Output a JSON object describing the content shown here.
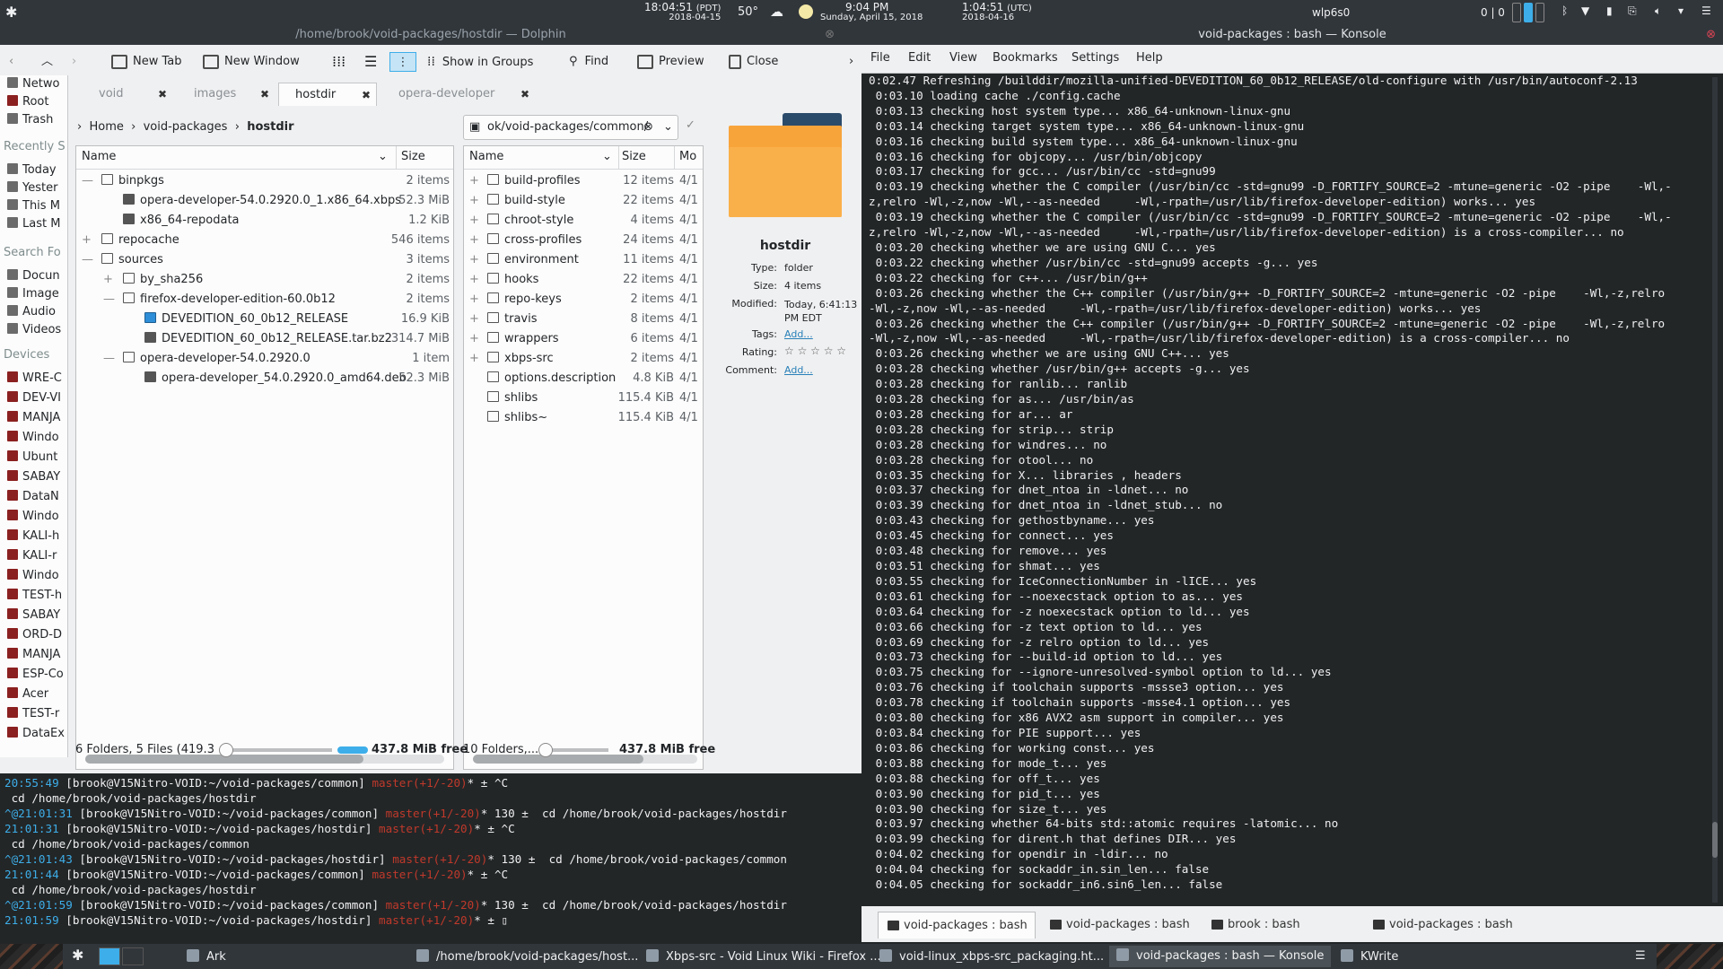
{
  "topbar": {
    "app_icon": "kde-icon",
    "time_pdt": "18:04:51",
    "tz_pdt": "(PDT)",
    "date_pdt": "2018-04-15",
    "temp": "50°",
    "time_local": "9:04 PM",
    "date_local": "Sunday, April 15, 2018",
    "time_utc": "1:04:51",
    "tz_utc": "(UTC)",
    "date_utc": "2018-04-16",
    "network": "wlp6s0",
    "counter": "0 | 0"
  },
  "dolphin": {
    "window_title": "/home/brook/void-packages/hostdir — Dolphin",
    "toolbar": {
      "new_tab": "New Tab",
      "new_window": "New Window",
      "show_in_groups": "Show in Groups",
      "find": "Find",
      "preview": "Preview",
      "close": "Close"
    },
    "places": {
      "items_top": [
        "Netwo",
        "Root",
        "Trash"
      ],
      "recent_header": "Recently S",
      "recent": [
        "Today",
        "Yester",
        "This M",
        "Last M"
      ],
      "search_header": "Search Fo",
      "search": [
        "Docun",
        "Image",
        "Audio",
        "Videos"
      ],
      "devices_header": "Devices",
      "devices": [
        "WRE-C",
        "DEV-VI",
        "MANJA",
        "Windo",
        "Ubunt",
        "SABAY",
        "DataN",
        "Windo",
        "KALI-h",
        "KALI-r",
        "Windo",
        "TEST-h",
        "SABAY",
        "ORD-D",
        "MANJA",
        "ESP-Co",
        "Acer",
        "TEST-r",
        "DataEx"
      ]
    },
    "tabs": [
      {
        "label": "void"
      },
      {
        "label": "images"
      },
      {
        "label": "hostdir"
      },
      {
        "label": "opera-developer"
      }
    ],
    "left_pane": {
      "breadcrumb": [
        "Home",
        "void-packages",
        "hostdir"
      ],
      "col_name": "Name",
      "col_size": "Size",
      "rows": [
        {
          "expander": "—",
          "name": "binpkgs",
          "size": "2 items"
        },
        {
          "expander": "",
          "name": "opera-developer-54.0.2920.0_1.x86_64.xbps",
          "size": "52.3 MiB"
        },
        {
          "expander": "",
          "name": "x86_64-repodata",
          "size": "1.2 KiB"
        },
        {
          "expander": "+",
          "name": "repocache",
          "size": "546 items"
        },
        {
          "expander": "—",
          "name": "sources",
          "size": "3 items"
        },
        {
          "expander": "+",
          "name": "by_sha256",
          "size": "2 items"
        },
        {
          "expander": "—",
          "name": "firefox-developer-edition-60.0b12",
          "size": "2 items"
        },
        {
          "expander": "",
          "name": "DEVEDITION_60_0b12_RELEASE",
          "size": "16.9 KiB"
        },
        {
          "expander": "",
          "name": "DEVEDITION_60_0b12_RELEASE.tar.bz2",
          "size": "314.7 MiB"
        },
        {
          "expander": "—",
          "name": "opera-developer-54.0.2920.0",
          "size": "1 item"
        },
        {
          "expander": "",
          "name": "opera-developer_54.0.2920.0_amd64.deb",
          "size": "52.3 MiB"
        }
      ],
      "status": "6 Folders, 5 Files (419.3 ...",
      "free": "437.8 MiB free"
    },
    "right_pane": {
      "location": "ok/void-packages/common/",
      "col_name": "Name",
      "col_size": "Size",
      "col_mod": "Mo",
      "rows": [
        {
          "name": "build-profiles",
          "size": "12 items",
          "mod": "4/1"
        },
        {
          "name": "build-style",
          "size": "22 items",
          "mod": "4/1"
        },
        {
          "name": "chroot-style",
          "size": "4 items",
          "mod": "4/1"
        },
        {
          "name": "cross-profiles",
          "size": "24 items",
          "mod": "4/1"
        },
        {
          "name": "environment",
          "size": "11 items",
          "mod": "4/1"
        },
        {
          "name": "hooks",
          "size": "22 items",
          "mod": "4/1"
        },
        {
          "name": "repo-keys",
          "size": "2 items",
          "mod": "4/1"
        },
        {
          "name": "travis",
          "size": "8 items",
          "mod": "4/1"
        },
        {
          "name": "wrappers",
          "size": "6 items",
          "mod": "4/1"
        },
        {
          "name": "xbps-src",
          "size": "2 items",
          "mod": "4/1"
        },
        {
          "name": "options.description",
          "size": "4.8 KiB",
          "mod": "4/1"
        },
        {
          "name": "shlibs",
          "size": "115.4 KiB",
          "mod": "4/1"
        },
        {
          "name": "shlibs~",
          "size": "115.4 KiB",
          "mod": "4/1"
        }
      ],
      "status": "10 Folders,...",
      "free": "437.8 MiB free"
    },
    "info": {
      "name": "hostdir",
      "type_label": "Type:",
      "type": "folder",
      "size_label": "Size:",
      "size": "4 items",
      "modified_label": "Modified:",
      "modified": "Today, 6:41:13 PM EDT",
      "tags_label": "Tags:",
      "tags": "Add...",
      "rating_label": "Rating:",
      "rating": "☆ ☆ ☆ ☆ ☆",
      "comment_label": "Comment:",
      "comment": "Add..."
    }
  },
  "konsole": {
    "window_title": "void-packages : bash — Konsole",
    "menu": [
      "File",
      "Edit",
      "View",
      "Bookmarks",
      "Settings",
      "Help"
    ],
    "lines": [
      "0:02.47 Refreshing /builddir/mozilla-unified-DEVEDITION_60_0b12_RELEASE/old-configure with /usr/bin/autoconf-2.13",
      " 0:03.10 loading cache ./config.cache",
      " 0:03.13 checking host system type... x86_64-unknown-linux-gnu",
      " 0:03.14 checking target system type... x86_64-unknown-linux-gnu",
      " 0:03.16 checking build system type... x86_64-unknown-linux-gnu",
      " 0:03.16 checking for objcopy... /usr/bin/objcopy",
      " 0:03.17 checking for gcc... /usr/bin/cc -std=gnu99",
      " 0:03.19 checking whether the C compiler (/usr/bin/cc -std=gnu99 -D_FORTIFY_SOURCE=2 -mtune=generic -O2 -pipe    -Wl,-",
      "z,relro -Wl,-z,now -Wl,--as-needed     -Wl,-rpath=/usr/lib/firefox-developer-edition) works... yes",
      " 0:03.19 checking whether the C compiler (/usr/bin/cc -std=gnu99 -D_FORTIFY_SOURCE=2 -mtune=generic -O2 -pipe    -Wl,-",
      "z,relro -Wl,-z,now -Wl,--as-needed     -Wl,-rpath=/usr/lib/firefox-developer-edition) is a cross-compiler... no",
      " 0:03.20 checking whether we are using GNU C... yes",
      " 0:03.22 checking whether /usr/bin/cc -std=gnu99 accepts -g... yes",
      " 0:03.22 checking for c++... /usr/bin/g++",
      " 0:03.26 checking whether the C++ compiler (/usr/bin/g++ -D_FORTIFY_SOURCE=2 -mtune=generic -O2 -pipe    -Wl,-z,relro",
      "-Wl,-z,now -Wl,--as-needed     -Wl,-rpath=/usr/lib/firefox-developer-edition) works... yes",
      " 0:03.26 checking whether the C++ compiler (/usr/bin/g++ -D_FORTIFY_SOURCE=2 -mtune=generic -O2 -pipe    -Wl,-z,relro",
      "-Wl,-z,now -Wl,--as-needed     -Wl,-rpath=/usr/lib/firefox-developer-edition) is a cross-compiler... no",
      " 0:03.26 checking whether we are using GNU C++... yes",
      " 0:03.28 checking whether /usr/bin/g++ accepts -g... yes",
      " 0:03.28 checking for ranlib... ranlib",
      " 0:03.28 checking for as... /usr/bin/as",
      " 0:03.28 checking for ar... ar",
      " 0:03.28 checking for strip... strip",
      " 0:03.28 checking for windres... no",
      " 0:03.28 checking for otool... no",
      " 0:03.35 checking for X... libraries , headers",
      " 0:03.37 checking for dnet_ntoa in -ldnet... no",
      " 0:03.39 checking for dnet_ntoa in -ldnet_stub... no",
      " 0:03.43 checking for gethostbyname... yes",
      " 0:03.45 checking for connect... yes",
      " 0:03.48 checking for remove... yes",
      " 0:03.51 checking for shmat... yes",
      " 0:03.55 checking for IceConnectionNumber in -lICE... yes",
      " 0:03.61 checking for --noexecstack option to as... yes",
      " 0:03.64 checking for -z noexecstack option to ld... yes",
      " 0:03.66 checking for -z text option to ld... yes",
      " 0:03.69 checking for -z relro option to ld... yes",
      " 0:03.73 checking for --build-id option to ld... yes",
      " 0:03.75 checking for --ignore-unresolved-symbol option to ld... yes",
      " 0:03.76 checking if toolchain supports -mssse3 option... yes",
      " 0:03.78 checking if toolchain supports -msse4.1 option... yes",
      " 0:03.80 checking for x86 AVX2 asm support in compiler... yes",
      " 0:03.84 checking for PIE support... yes",
      " 0:03.86 checking for working const... yes",
      " 0:03.88 checking for mode_t... yes",
      " 0:03.88 checking for off_t... yes",
      " 0:03.90 checking for pid_t... yes",
      " 0:03.90 checking for size_t... yes",
      " 0:03.97 checking whether 64-bits std::atomic requires -latomic... no",
      " 0:03.99 checking for dirent.h that defines DIR... yes",
      " 0:04.02 checking for opendir in -ldir... no",
      " 0:04.04 checking for sockaddr_in.sin_len... false",
      " 0:04.05 checking for sockaddr_in6.sin6_len... false"
    ],
    "tabs": [
      "void-packages : bash",
      "void-packages : bash",
      "brook : bash",
      "void-packages : bash"
    ]
  },
  "embedded_terminal": {
    "lines": [
      {
        "time": "20:55:49",
        "prompt": " [brook@V15Nitro-VOID:~/void-packages/common]",
        "git": " master(+1/-20)",
        "tail": "* ± ^C"
      },
      {
        "time": "",
        "prompt": " cd /home/brook/void-packages/hostdir",
        "git": "",
        "tail": ""
      },
      {
        "time": "^@21:01:31",
        "prompt": " [brook@V15Nitro-VOID:~/void-packages/common]",
        "git": " master(+1/-20)",
        "tail": "* 130 ±  cd /home/brook/void-packages/hostdir"
      },
      {
        "time": "21:01:31",
        "prompt": " [brook@V15Nitro-VOID:~/void-packages/hostdir]",
        "git": " master(+1/-20)",
        "tail": "* ± ^C"
      },
      {
        "time": "",
        "prompt": " cd /home/brook/void-packages/common",
        "git": "",
        "tail": ""
      },
      {
        "time": "^@21:01:43",
        "prompt": " [brook@V15Nitro-VOID:~/void-packages/hostdir]",
        "git": " master(+1/-20)",
        "tail": "* 130 ±  cd /home/brook/void-packages/common"
      },
      {
        "time": "21:01:44",
        "prompt": " [brook@V15Nitro-VOID:~/void-packages/common]",
        "git": " master(+1/-20)",
        "tail": "* ± ^C"
      },
      {
        "time": "",
        "prompt": " cd /home/brook/void-packages/hostdir",
        "git": "",
        "tail": ""
      },
      {
        "time": "^@21:01:59",
        "prompt": " [brook@V15Nitro-VOID:~/void-packages/common]",
        "git": " master(+1/-20)",
        "tail": "* 130 ±  cd /home/brook/void-packages/hostdir"
      },
      {
        "time": "21:01:59",
        "prompt": " [brook@V15Nitro-VOID:~/void-packages/hostdir]",
        "git": " master(+1/-20)",
        "tail": "* ± ▯"
      }
    ]
  },
  "taskbar": {
    "items": [
      "Ark",
      "/home/brook/void-packages/host...",
      "Xbps-src - Void Linux Wiki - Firefox ...",
      "void-linux_xbps-src_packaging.ht...",
      "void-packages : bash — Konsole",
      "KWrite"
    ]
  },
  "colors": {
    "accent": "#3daee9",
    "git": "#c0392b",
    "panel": "#31363b"
  }
}
